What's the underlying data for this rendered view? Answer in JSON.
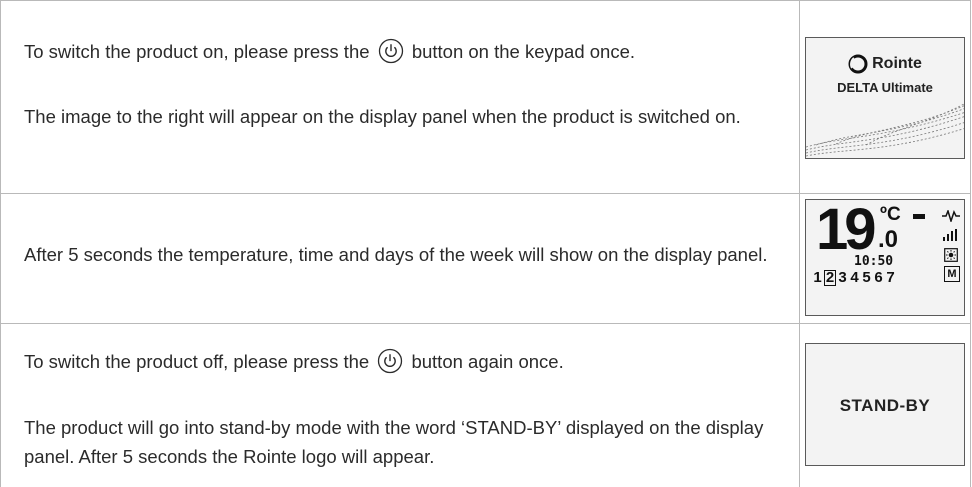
{
  "rows": [
    {
      "p1_before": "To switch the product on, please press the",
      "p1_after": "button on the keypad once.",
      "p2": "The image to the right will appear on the display panel when the product is switched on."
    },
    {
      "p1": "After 5 seconds the temperature, time and days of the week will show on the display panel."
    },
    {
      "p1_before": "To switch the product off, please press the",
      "p1_after": "button again once.",
      "p2": "The product will go into stand-by mode with the word ‘STAND-BY’ displayed on the display panel. After 5 seconds the Rointe logo will appear."
    }
  ],
  "displays": {
    "logo": {
      "brand": "Rointe",
      "model": "DELTA Ultimate"
    },
    "lcd": {
      "temp_int": "19",
      "temp_unit": "ºC",
      "temp_dec": ".0",
      "time": "10:50",
      "days": [
        "1",
        "2",
        "3",
        "4",
        "5",
        "6",
        "7"
      ],
      "selected_day": "2",
      "mode": "M"
    },
    "standby": {
      "text": "STAND-BY"
    }
  },
  "icons": [
    "power-icon",
    "rointe-logo-icon",
    "wave-pattern-icon",
    "heating-wave-icon",
    "signal-icon",
    "sun-icon"
  ]
}
